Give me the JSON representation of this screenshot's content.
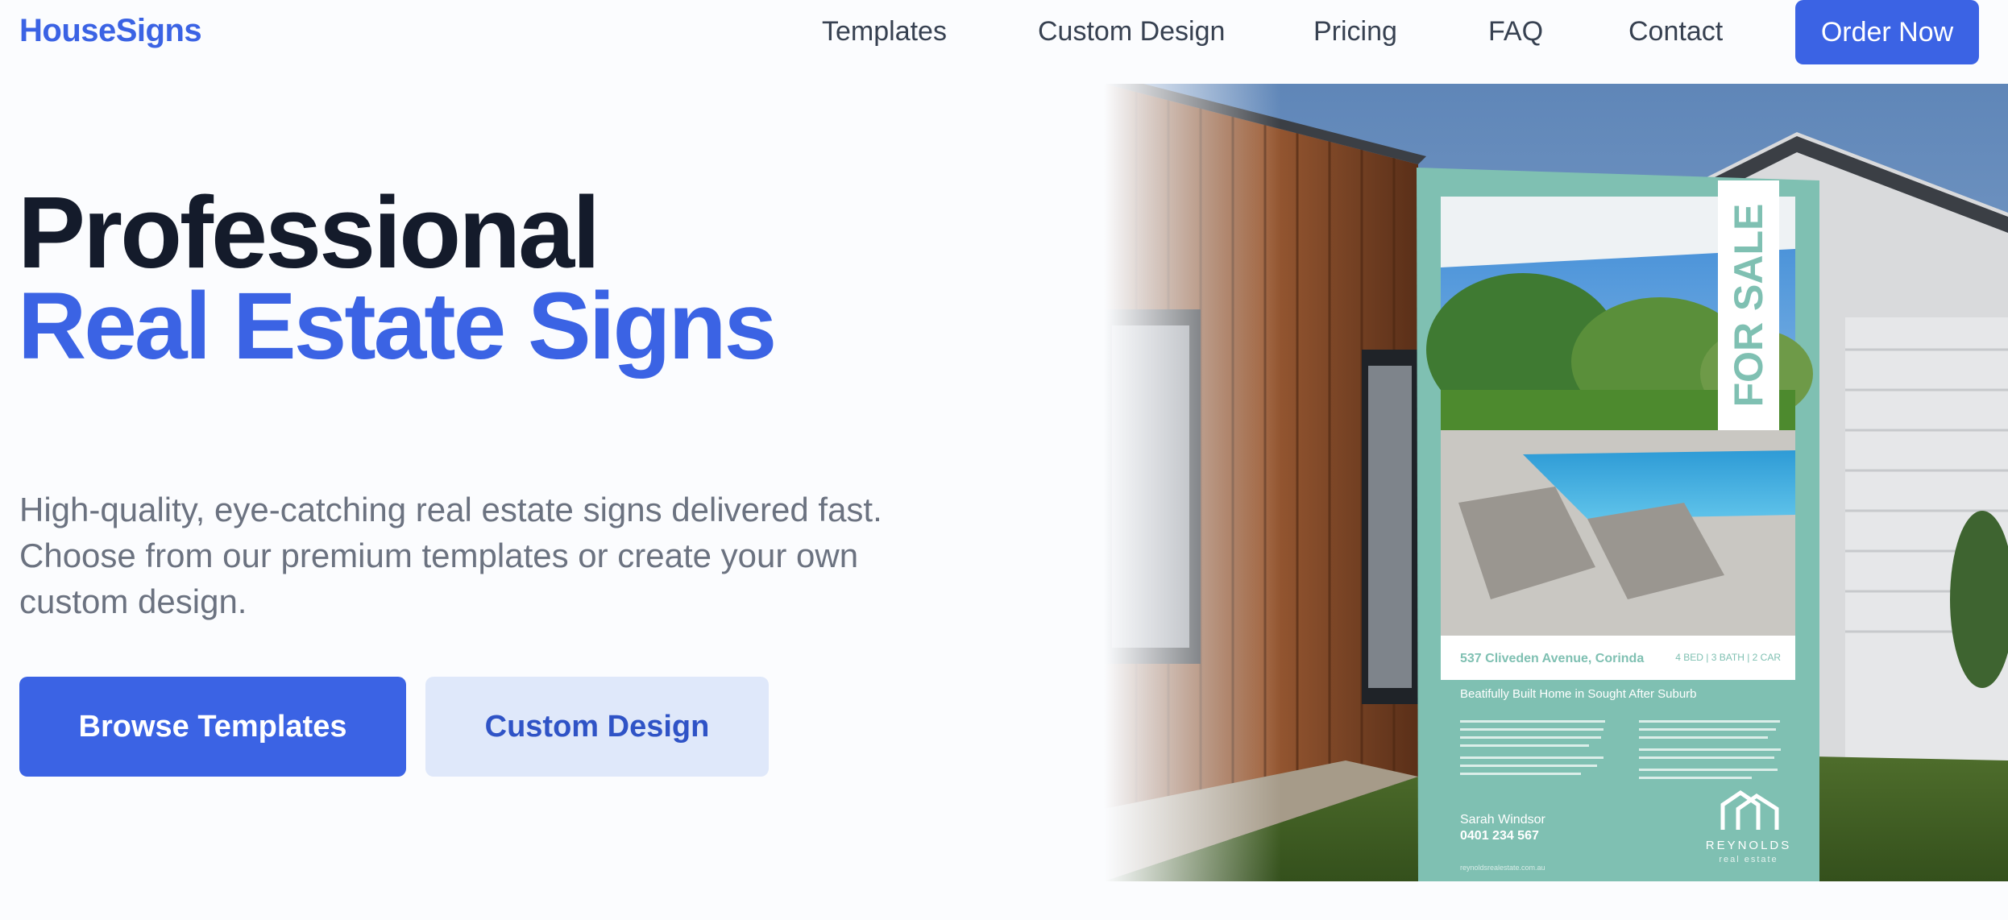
{
  "nav": {
    "brand": "HouseSigns",
    "links": [
      "Templates",
      "Custom Design",
      "Pricing",
      "FAQ",
      "Contact"
    ],
    "cta": "Order Now"
  },
  "hero": {
    "title_line1": "Professional",
    "title_line2": "Real Estate Signs",
    "subtitle": "High-quality, eye-catching real estate signs delivered fast. Choose from our premium templates or create your own custom design.",
    "primary_button": "Browse Templates",
    "secondary_button": "Custom Design"
  },
  "sign": {
    "banner": "FOR SALE",
    "address": "537 Cliveden Avenue, Corinda",
    "specs": "4 BED | 3 BATH | 2 CAR",
    "headline": "Beatifully Built Home in Sought After Suburb",
    "agent_name": "Sarah Windsor",
    "agent_phone": "0401 234 567",
    "agency": "REYNOLDS",
    "agency_sub": "real estate",
    "website": "reynoldsrealestate.com.au"
  },
  "colors": {
    "accent": "#3b63e4",
    "heading": "#141b2b",
    "sign_teal": "#7fc0b2"
  }
}
